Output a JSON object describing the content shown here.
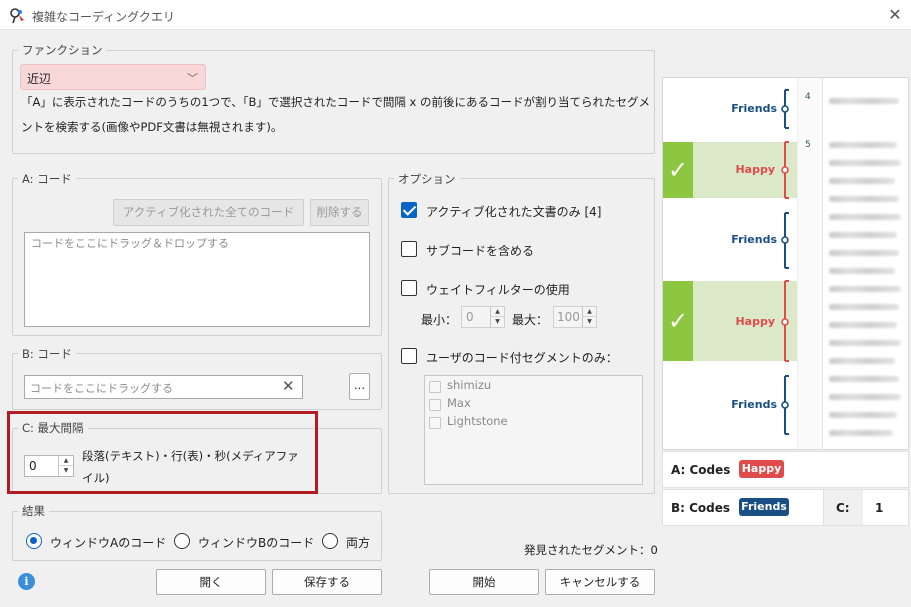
{
  "window": {
    "title": "複雑なコーディングクエリ"
  },
  "function_group": {
    "legend": "ファンクション",
    "selected": "近辺",
    "description": "「A」に表示されたコードのうちの1つで、「B」で選択されたコードで間隔 x の前後にあるコードが割り当てられたセグメントを検索する(画像やPDF文書は無視されます)。"
  },
  "code_a": {
    "legend": "A: コード",
    "activated_button": "アクティブ化された全てのコード",
    "delete_button": "削除する",
    "placeholder": "コードをここにドラッグ＆ドロップする"
  },
  "code_b": {
    "legend": "B: コード",
    "placeholder": "コードをここにドラッグする",
    "more_button": "..."
  },
  "code_c": {
    "legend": "C: 最大間隔",
    "value": "0",
    "unit_label": "段落(テキスト)・行(表)・秒(メディアファイル)"
  },
  "options": {
    "legend": "オプション",
    "activated_docs_only": "アクティブ化された文書のみ [4]",
    "include_subcodes": "サブコードを含める",
    "weight_filter": "ウェイトフィルターの使用",
    "min_label": "最小：",
    "min_value": "0",
    "max_label": "最大：",
    "max_value": "100",
    "user_segments_only": "ユーザのコード付セグメントのみ：",
    "users": [
      "shimizu",
      "Max",
      "Lightstone"
    ]
  },
  "result": {
    "legend": "結果",
    "radio_a": "ウィンドウAのコード",
    "radio_b": "ウィンドウBのコード",
    "radio_both": "両方"
  },
  "found_segments": "発見されたセグメント：0",
  "buttons": {
    "open": "開く",
    "save": "保存する",
    "start": "開始",
    "cancel": "キャンセルする"
  },
  "preview": {
    "line_numbers": [
      "4",
      "5"
    ],
    "labels": [
      "Friends",
      "Happy",
      "Friends",
      "Happy",
      "Friends"
    ],
    "a_codes_label": "A: Codes",
    "b_codes_label": "B: Codes",
    "a_tag": "Happy",
    "b_tag": "Friends",
    "c_label": "C:",
    "c_value": "1"
  },
  "colors": {
    "accent": "#0a64c8",
    "happy": "#e04b4b",
    "friends": "#1a4f86",
    "check_green": "#8dc640",
    "highlight_red": "#b01c22"
  }
}
